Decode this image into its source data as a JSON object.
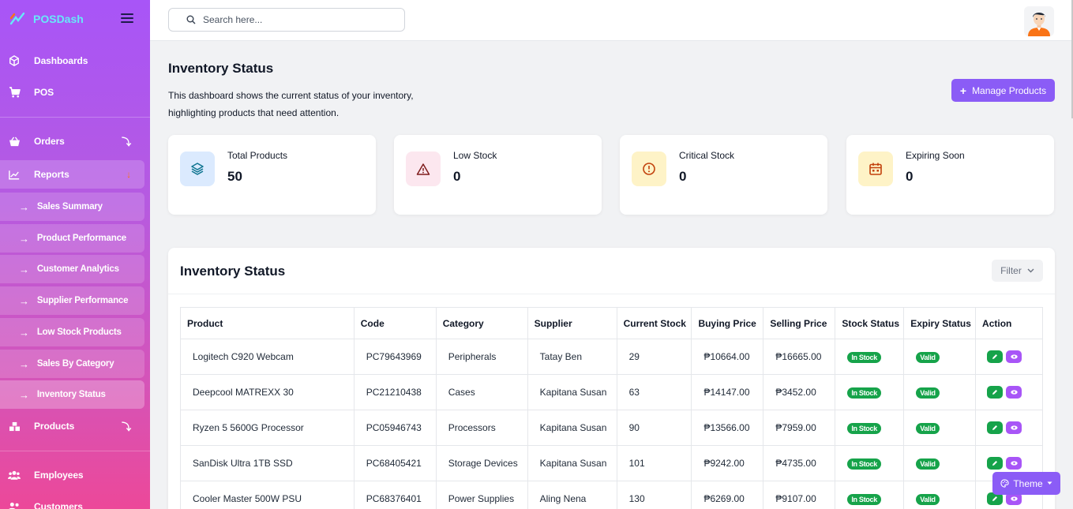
{
  "brand": {
    "name": "POSDash"
  },
  "nav": {
    "dashboards": "Dashboards",
    "pos": "POS",
    "orders": "Orders",
    "reports": "Reports",
    "reports_sub": [
      "Sales Summary",
      "Product Performance",
      "Customer Analytics",
      "Supplier Performance",
      "Low Stock Products",
      "Sales By Category",
      "Inventory Status"
    ],
    "products": "Products",
    "employees": "Employees",
    "customers": "Customers"
  },
  "search": {
    "placeholder": "Search here..."
  },
  "page": {
    "title": "Inventory Status",
    "description": "This dashboard shows the current status of your inventory, highlighting products that need attention.",
    "manage_button": "Manage Products"
  },
  "cards": [
    {
      "label": "Total Products",
      "value": "50",
      "icon": "layers-icon",
      "color": "#dbeafe"
    },
    {
      "label": "Low Stock",
      "value": "0",
      "icon": "warning-triangle-icon",
      "color": "#fce7ef"
    },
    {
      "label": "Critical Stock",
      "value": "0",
      "icon": "alert-circle-icon",
      "color": "#fef3c7"
    },
    {
      "label": "Expiring Soon",
      "value": "0",
      "icon": "calendar-icon",
      "color": "#fef3c7"
    }
  ],
  "table_panel": {
    "title": "Inventory Status",
    "filter_label": "Filter",
    "columns": [
      "Product",
      "Code",
      "Category",
      "Supplier",
      "Current Stock",
      "Buying Price",
      "Selling Price",
      "Stock Status",
      "Expiry Status",
      "Action"
    ],
    "rows": [
      [
        "Logitech C920 Webcam",
        "PC79643969",
        "Peripherals",
        "Tatay Ben",
        "29",
        "₱10664.00",
        "₱16665.00",
        "In Stock",
        "Valid"
      ],
      [
        "Deepcool MATREXX 30",
        "PC21210438",
        "Cases",
        "Kapitana Susan",
        "63",
        "₱14147.00",
        "₱3452.00",
        "In Stock",
        "Valid"
      ],
      [
        "Ryzen 5 5600G Processor",
        "PC05946743",
        "Processors",
        "Kapitana Susan",
        "90",
        "₱13566.00",
        "₱7959.00",
        "In Stock",
        "Valid"
      ],
      [
        "SanDisk Ultra 1TB SSD",
        "PC68405421",
        "Storage Devices",
        "Kapitana Susan",
        "101",
        "₱9242.00",
        "₱4735.00",
        "In Stock",
        "Valid"
      ],
      [
        "Cooler Master 500W PSU",
        "PC68376401",
        "Power Supplies",
        "Aling Nena",
        "130",
        "₱6269.00",
        "₱9107.00",
        "In Stock",
        "Valid"
      ]
    ]
  },
  "theme_button": "Theme",
  "colors": {
    "accent": "#8b5cf6",
    "success": "#16a34a"
  }
}
